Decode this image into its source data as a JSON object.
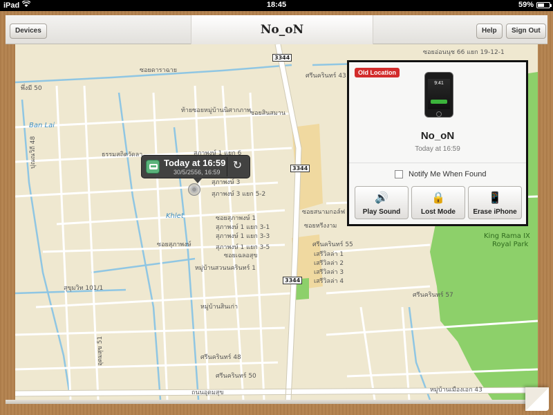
{
  "status": {
    "carrier": "iPad",
    "time": "18:45",
    "battery": "59%",
    "battery_level": 0.59
  },
  "toolbar": {
    "devices_label": "Devices",
    "title": "No_oN",
    "help_label": "Help",
    "signout_label": "Sign Out"
  },
  "callout": {
    "title": "Today at 16:59",
    "subtitle": "30/5/2556, 16:59",
    "refresh_glyph": "↻"
  },
  "panel": {
    "badge": "Old Location",
    "phone_clock": "9:41",
    "device_name": "No_oN",
    "located_time": "Today at 16:59",
    "notify_label": "Notify Me When Found",
    "actions": [
      {
        "label": "Play Sound",
        "icon": "🔊"
      },
      {
        "label": "Lost Mode",
        "icon": "🔒"
      },
      {
        "label": "Erase iPhone",
        "icon": "📱"
      }
    ]
  },
  "map": {
    "colors": {
      "land": "#efe8d0",
      "road": "#ffffff",
      "major_road": "#f8f6ec",
      "water": "#8fc6e3",
      "park": "#8dd06a",
      "beige_block": "#f0d9a0"
    },
    "labels": [
      "ซอยอ่อนนุช 66 แยก 19-12-1",
      "ศรีนครินทร์ 43",
      "Ban Lai",
      "พึ่งมี 50",
      "ซอยดาราฉาย",
      "ท้ายซอยหมู่บ้านนิศากภาพ",
      "ซอยสินสมาน",
      "ธรรมสถิตวัดลา",
      "สุภาพงษ์ 1 แยก 6",
      "สุภาพงษ์ 3",
      "สุภาพงษ์ 3 แยก 5-2",
      "Khlet",
      "ซอยสุภาพงษ์ 1",
      "สุภาพงษ์ 1 แยก 3-1",
      "สุภาพงษ์ 1 แยก 3-3",
      "สุภาพงษ์ 1 แยก 3-5",
      "ซอยเฉลอสุข",
      "หมู่บ้านสวนนครินทร์ 1",
      "ซอยสุภาพงษ์",
      "ศรีนครินทร์ 55",
      "เสรีวิลล่า 1",
      "เสรีวิลล่า 2",
      "เสรีวิลล่า 3",
      "เสรีวิลล่า 4",
      "King Rama IX",
      "Royal Park",
      "ศรีนครินทร์ 57",
      "สุขุมวิท 101/1",
      "หมู่บ้านสินเก่า",
      "ศรีนครินทร์ 48",
      "ศรีนครินทร์ 50",
      "ถนนอุดมสุข",
      "ซอยสนามกอล์ฟ",
      "ซอยหรีงงาม",
      "หมู่บ้านเมืองเอก 43",
      "ปุณณวิถี 48",
      "อุดมสุข 51",
      "3344",
      "3344",
      "3344"
    ]
  }
}
